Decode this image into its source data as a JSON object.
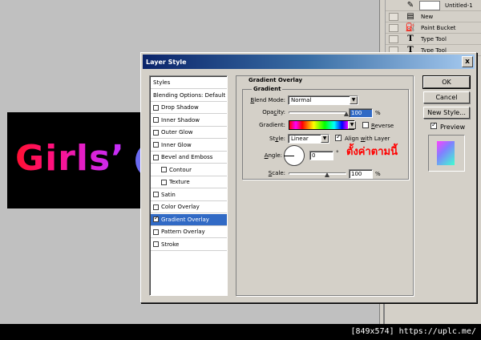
{
  "canvas": {
    "text": "Girls’"
  },
  "history_panel": {
    "items": [
      {
        "label": "Untitled-1",
        "icon": "document-thumbnail"
      },
      {
        "label": "New",
        "icon": "new-document-icon"
      },
      {
        "label": "Paint Bucket",
        "icon": "paint-bucket-icon"
      },
      {
        "label": "Type Tool",
        "icon": "type-tool-icon"
      },
      {
        "label": "Type Tool",
        "icon": "type-tool-icon"
      }
    ]
  },
  "dialog": {
    "title": "Layer Style",
    "close_glyph": "x",
    "styles_list": [
      {
        "label": "Styles",
        "checkbox": false,
        "checked": false,
        "selected": false
      },
      {
        "label": "Blending Options: Default",
        "checkbox": false,
        "checked": false,
        "selected": false
      },
      {
        "label": "Drop Shadow",
        "checkbox": true,
        "checked": false,
        "selected": false
      },
      {
        "label": "Inner Shadow",
        "checkbox": true,
        "checked": false,
        "selected": false
      },
      {
        "label": "Outer Glow",
        "checkbox": true,
        "checked": false,
        "selected": false
      },
      {
        "label": "Inner Glow",
        "checkbox": true,
        "checked": false,
        "selected": false
      },
      {
        "label": "Bevel and Emboss",
        "checkbox": true,
        "checked": false,
        "selected": false
      },
      {
        "label": "Contour",
        "checkbox": true,
        "checked": false,
        "selected": false,
        "indent": true
      },
      {
        "label": "Texture",
        "checkbox": true,
        "checked": false,
        "selected": false,
        "indent": true
      },
      {
        "label": "Satin",
        "checkbox": true,
        "checked": false,
        "selected": false
      },
      {
        "label": "Color Overlay",
        "checkbox": true,
        "checked": false,
        "selected": false
      },
      {
        "label": "Gradient Overlay",
        "checkbox": true,
        "checked": true,
        "selected": true
      },
      {
        "label": "Pattern Overlay",
        "checkbox": true,
        "checked": false,
        "selected": false
      },
      {
        "label": "Stroke",
        "checkbox": true,
        "checked": false,
        "selected": false
      }
    ],
    "group_title": "Gradient Overlay",
    "subgroup_title": "Gradient",
    "blend_mode": {
      "label_hot": "B",
      "label_rest": "lend Mode:",
      "value": "Normal"
    },
    "opacity": {
      "label_rest": "Opa",
      "label_hot": "c",
      "label_tail": "ity:",
      "value": "100",
      "unit": "%",
      "level": 100
    },
    "gradient": {
      "label": "Gradient:",
      "reverse_label_hot": "R",
      "reverse_label_rest": "everse",
      "reverse_checked": false
    },
    "style": {
      "label_rest": "St",
      "label_hot": "y",
      "label_tail": "le:",
      "value": "Linear",
      "align_label_rest": "Align ",
      "align_label_hot": "w",
      "align_label_tail": "ith Layer",
      "align_checked": true
    },
    "angle": {
      "label_hot": "A",
      "label_rest": "ngle:",
      "value": "0",
      "unit": "°"
    },
    "scale": {
      "label_hot": "S",
      "label_rest": "cale:",
      "value": "100",
      "unit": "%",
      "level": 100
    },
    "annotation": "ตั้งค่าตามนี้",
    "buttons": {
      "ok": "OK",
      "cancel": "Cancel",
      "new_style": "New Style...",
      "preview": "Preview"
    },
    "preview_checked": true
  },
  "status_bar": {
    "text": "[849x574] https://uplc.me/"
  },
  "colors": {
    "titlebar_start": "#0a246a",
    "titlebar_end": "#a6caf0",
    "selection": "#316ac5",
    "annotation": "#ff0000",
    "dialog_face": "#d4d0c8"
  }
}
